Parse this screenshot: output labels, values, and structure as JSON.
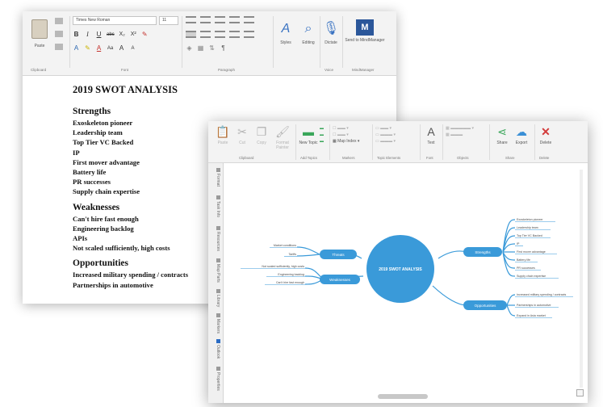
{
  "word": {
    "font_name": "Times New Roman",
    "font_size": "11",
    "ribbon": {
      "paste_label": "Paste",
      "styles_label": "Styles",
      "editing_label": "Editing",
      "dictate_label": "Dictate",
      "send_label": "Send to MindManager",
      "groups": {
        "clipboard": "Clipboard",
        "font": "Font",
        "paragraph": "Paragraph",
        "voice": "Voice",
        "mindmanager": "MindManager"
      },
      "format_buttons": [
        "B",
        "I",
        "U",
        "abc",
        "X₂",
        "X²",
        "A",
        "A",
        "Aa",
        "A",
        "A"
      ]
    },
    "document": {
      "title": "2019 SWOT ANALYSIS",
      "sections": [
        {
          "heading": "Strengths",
          "items": [
            "Exoskeleton pioneer",
            "Leadership team",
            "Top Tier VC Backed",
            "IP",
            "First mover advantage",
            "Battery life",
            "PR successes",
            "Supply chain expertise"
          ]
        },
        {
          "heading": "Weaknesses",
          "items": [
            "Can't hire fast enough",
            "Engineering backlog",
            "APIs",
            "Not scaled sufficiently, high costs"
          ]
        },
        {
          "heading": "Opportunities",
          "items": [
            "Increased military spending / contracts",
            "Partnerships in automotive"
          ]
        }
      ]
    }
  },
  "mindmanager": {
    "ribbon": {
      "paste_label": "Paste",
      "cut_label": "Cut",
      "copy_label": "Copy",
      "format_painter_label": "Format Painter",
      "new_topic_label": "New Topic",
      "text_label": "Text",
      "export_label": "Export",
      "share_label": "Share",
      "delete_label": "Delete",
      "map_index_label": "Map Index",
      "groups": {
        "clipboard": "Clipboard",
        "add_topics": "Add Topics",
        "markers": "Markers",
        "topic_elements": "Topic Elements",
        "font": "Font",
        "objects": "Objects",
        "share": "Share",
        "delete": "Delete"
      }
    },
    "sidebar_tabs": [
      "Format",
      "Task Info",
      "Resources",
      "Map Parts",
      "Library",
      "Markers",
      "Outlook",
      "Properties"
    ],
    "map": {
      "center": "2019 SWOT ANALYSIS",
      "branches": {
        "strengths": {
          "label": "Strengths",
          "subtopics": [
            "Exoskeleton pioneer",
            "Leadership team",
            "Top Tier VC Backed",
            "IP",
            "First mover advantage",
            "Battery life",
            "PR successes",
            "Supply chain expertise"
          ]
        },
        "weaknesses": {
          "label": "Weaknesses",
          "subtopics": [
            "Can't hire fast enough",
            "Engineering backlog",
            "APIs",
            "Not scaled sufficiently, high costs"
          ]
        },
        "opportunities": {
          "label": "Opportunities",
          "subtopics": [
            "Increased military spending / contracts",
            "Partnerships in automotive",
            "Expand in Asia market"
          ]
        },
        "threats": {
          "label": "Threats",
          "subtopics": [
            "Market conditions",
            "Tariffs"
          ]
        }
      }
    }
  },
  "colors": {
    "mindmap_blue": "#3a9ad9",
    "word_blue": "#2b579a",
    "share_green": "#3aa65a",
    "delete_red": "#d33b3b"
  }
}
